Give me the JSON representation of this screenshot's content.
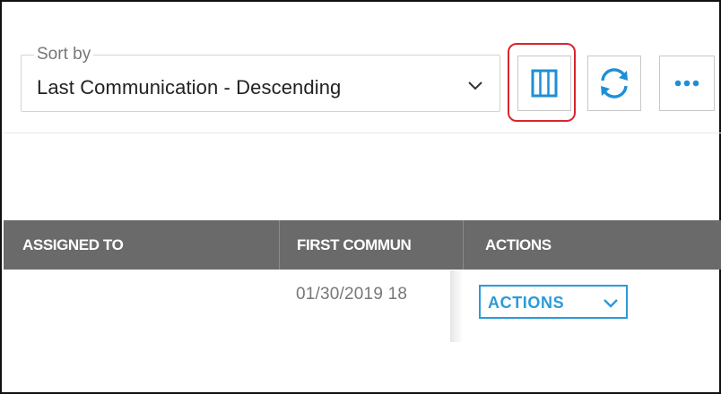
{
  "sort": {
    "legend": "Sort by",
    "value": "Last Communication - Descending",
    "dropdown_icon": "chevron-down-icon"
  },
  "toolbar": {
    "columns_icon": "columns-icon",
    "refresh_icon": "refresh-icon",
    "more_icon": "more-horizontal-icon",
    "accent_color": "#1e8fd6",
    "highlight_color": "#d8262d"
  },
  "table": {
    "headers": [
      "ASSIGNED TO",
      "FIRST COMMUN",
      "ACTIONS"
    ],
    "header_bg": "#6a6a6a",
    "rows": [
      {
        "assigned_to": "",
        "first_communication": "01/30/2019 18",
        "actions_label": "ACTIONS"
      }
    ]
  }
}
